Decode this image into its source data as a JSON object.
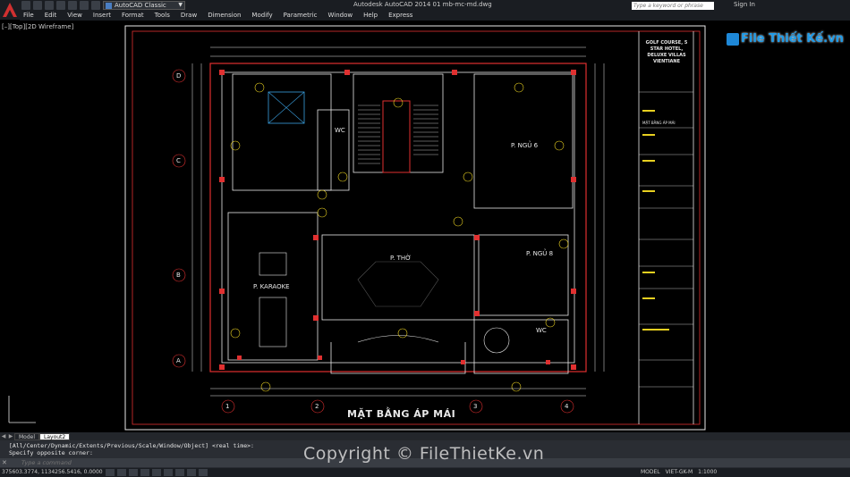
{
  "app": {
    "window_title": "Autodesk AutoCAD 2014    01 mb-mc-md.dwg",
    "workspace": "AutoCAD Classic",
    "search_placeholder": "Type a keyword or phrase",
    "sign_in": "Sign In"
  },
  "menu": [
    "File",
    "Edit",
    "View",
    "Insert",
    "Format",
    "Tools",
    "Draw",
    "Dimension",
    "Modify",
    "Parametric",
    "Window",
    "Help",
    "Express"
  ],
  "viewport_label": "[–][Top][2D Wireframe]",
  "watermark": "File Thiết Kế.vn",
  "drawing": {
    "sheet_title": "MẶT BẰNG ÁP MÁI",
    "rooms": [
      "WC",
      "P. NGỦ 6",
      "P. THỜ",
      "P. NGỦ 8",
      "P. KARAOKE",
      "WC"
    ],
    "grid_rows": [
      "D",
      "C",
      "B",
      "A"
    ],
    "grid_cols": [
      "1",
      "2",
      "3",
      "4"
    ],
    "title_block": {
      "project": "GOLF COURSE, 5 STAR HOTEL, DELUXE VILLAS VIENTIANE",
      "sheet": "MẶT BẰNG ÁP MÁI"
    }
  },
  "tabs": [
    "Model",
    "Layout2"
  ],
  "active_tab": "Layout2",
  "command": {
    "history": [
      "[All/Center/Dynamic/Extents/Previous/Scale/Window/Object] <real time>:",
      "Specify opposite corner:"
    ],
    "placeholder": "Type a command"
  },
  "status": {
    "coords": "375603.3774, 1134256.5416, 0.0000",
    "model": "MODEL",
    "font": "VIET-GK-M",
    "scale": "1:1000"
  },
  "copyright": "Copyright © FileThietKe.vn",
  "colors": {
    "wall_red": "#e03030",
    "frame_white": "#e8e8e8",
    "accent_yellow": "#e8d020",
    "title_bar": "#1a1d22"
  }
}
